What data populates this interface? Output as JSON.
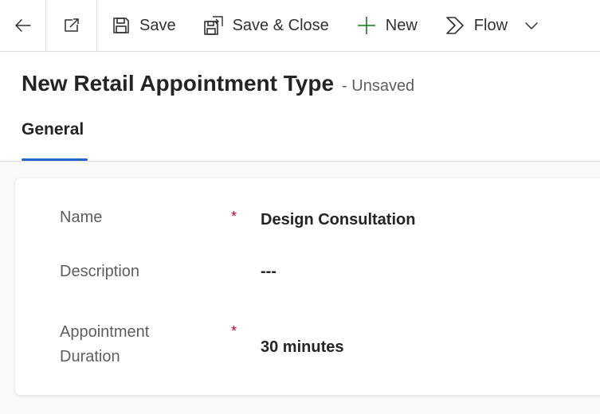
{
  "toolbar": {
    "back_icon": "arrow-left-icon",
    "popout_icon": "open-in-new-window-icon",
    "save_label": "Save",
    "save_close_label": "Save & Close",
    "new_label": "New",
    "flow_label": "Flow",
    "more_icon": "chevron-down-icon"
  },
  "header": {
    "title": "New Retail Appointment Type",
    "status": "- Unsaved"
  },
  "tabs": [
    {
      "label": "General",
      "selected": true
    }
  ],
  "form": {
    "fields": [
      {
        "label": "Name",
        "required": true,
        "value": "Design Consultation"
      },
      {
        "label": "Description",
        "required": false,
        "value": "---"
      },
      {
        "label_line1": "Appointment",
        "label_line2": "Duration",
        "required": true,
        "value": "30 minutes"
      }
    ]
  },
  "colors": {
    "accent": "#2266c9",
    "required": "#c50f1f",
    "new_icon": "#107c10"
  }
}
